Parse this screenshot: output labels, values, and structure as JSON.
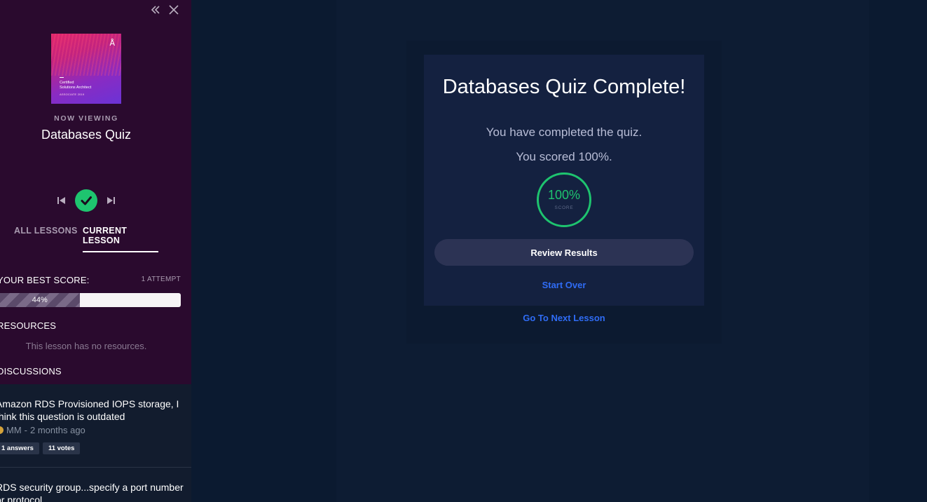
{
  "sidebar": {
    "icons": {
      "collapse": "double-chevron-left-icon",
      "close": "close-icon"
    },
    "cover": {
      "line1": "Certified",
      "line2": "Solutions Architect",
      "line3": "ASSOCIATE 2019"
    },
    "now_viewing_label": "NOW VIEWING",
    "lesson_title": "Databases Quiz",
    "player": {
      "prev": "skip-previous-icon",
      "status": "check-icon",
      "next": "skip-next-icon"
    },
    "tabs": [
      {
        "label": "ALL LESSONS"
      },
      {
        "label": "CURRENT LESSON"
      }
    ],
    "best_score": {
      "label": "YOUR BEST SCORE:",
      "attempts": "1 ATTEMPT",
      "value_label": "44%",
      "fraction": 0.44
    },
    "resources": {
      "heading": "RESOURCES",
      "empty_text": "This lesson has no resources."
    },
    "discussions": {
      "heading": "DISCUSSIONS",
      "items": [
        {
          "question": "Amazon RDS Provisioned IOPS storage, I think this question is outdated",
          "author": "MM",
          "time": "2 months ago",
          "answers": "1 answers",
          "votes": "11 votes"
        },
        {
          "question": "RDS security group...specify a port number or protocol"
        }
      ]
    }
  },
  "main": {
    "title": "Databases Quiz Complete!",
    "completed_msg": "You have completed the quiz.",
    "score_msg": "You scored 100%.",
    "score_ring": {
      "percent": "100%",
      "label": "SCORE",
      "fraction": 1.0
    },
    "review_button": "Review Results",
    "start_over": "Start Over",
    "next_lesson": "Go To Next Lesson"
  },
  "colors": {
    "sidebar_bg": "#2a0a2e",
    "page_bg": "#0b1a30",
    "card_bg": "#142140",
    "accent_green": "#1ec46f",
    "link_blue": "#2f6cf5"
  }
}
